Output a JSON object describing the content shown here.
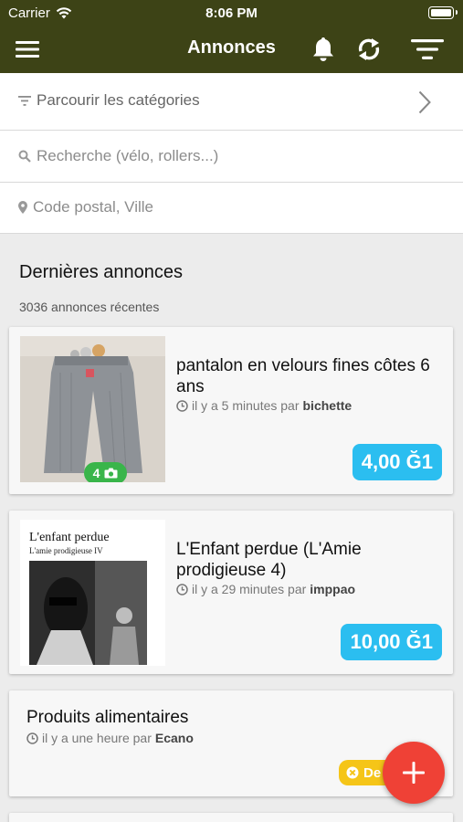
{
  "status_bar": {
    "carrier": "Carrier",
    "time": "8:06 PM"
  },
  "nav": {
    "title": "Annonces",
    "menu_icon": "menu-icon",
    "bell_icon": "bell-icon",
    "sync_icon": "sync-icon",
    "filter_icon": "filter-icon"
  },
  "filters": {
    "categories_label": "Parcourir les catégories",
    "search_placeholder": "Recherche (vélo, rollers...)",
    "location_placeholder": "Code postal, Ville"
  },
  "section": {
    "title": "Dernières annonces",
    "subtitle": "3036 annonces récentes"
  },
  "ads": [
    {
      "title": "pantalon en velours fines côtes 6 ans",
      "time": "il y a 5 minutes par",
      "author": "bichette",
      "price": "4,00 Ğ1",
      "photo_count": "4"
    },
    {
      "title": "L'Enfant perdue (L'Amie prodigieuse 4)",
      "time": "il y a 29 minutes par",
      "author": "imppao",
      "price": "10,00 Ğ1",
      "book_title": "L'enfant perdue",
      "book_subtitle": "L'amie prodigieuse IV"
    },
    {
      "title": "Produits alimentaires",
      "time": "il y a une heure par",
      "author": "Ecano",
      "badge": "De"
    }
  ],
  "colors": {
    "navbar": "#3d4316",
    "price": "#2bbef0",
    "fab": "#ef4136",
    "photo_badge": "#39b54a",
    "warning_badge": "#f5c518"
  }
}
